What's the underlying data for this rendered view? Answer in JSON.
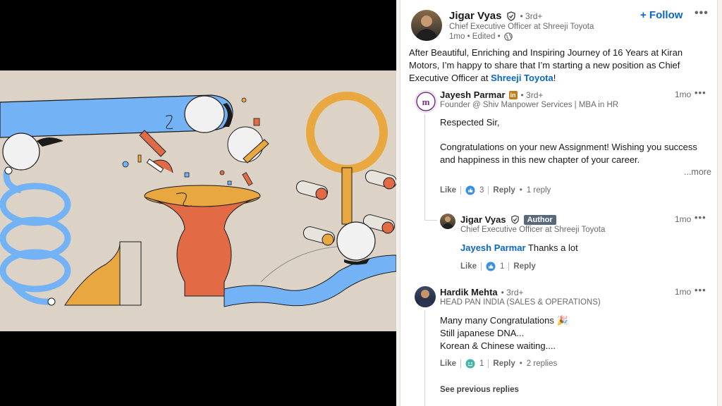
{
  "post": {
    "author_name": "Jigar Vyas",
    "author_degree": "• 3rd+",
    "author_headline": "Chief Executive Officer at Shreeji Toyota",
    "meta_time": "1mo • Edited •",
    "follow_label": "+ Follow",
    "more_label": "•••",
    "text_before": "After Beautiful, Enriching and Inspiring Journey of 16 Years at Kiran Motors, I’m happy to share that I’m starting a new position as Chief Executive Officer at ",
    "text_link": "Shreeji Toyota",
    "text_after": "!"
  },
  "comments": [
    {
      "name": "Jayesh Parmar",
      "degree": "• 3rd+",
      "headline": "Founder @ Shiv Manpower Services | MBA in HR",
      "time": "1mo",
      "line1": "Respected Sir,",
      "line2": "Congratulations on your new Assignment! Wishing you success",
      "line3": "and happiness in this new chapter of your career.",
      "see_more": "...more",
      "like_label": "Like",
      "reaction_count": "3",
      "reply_label": "Reply",
      "replies_label": "1 reply"
    },
    {
      "name": "Jigar Vyas",
      "badge": "Author",
      "headline": "Chief Executive Officer at Shreeji Toyota",
      "time": "1mo",
      "mention": "Jayesh Parmar",
      "text": " Thanks a lot",
      "like_label": "Like",
      "reaction_count": "1",
      "reply_label": "Reply"
    },
    {
      "name": "Hardik Mehta",
      "degree": "• 3rd+",
      "headline": "HEAD PAN INDIA (SALES & OPERATIONS)",
      "time": "1mo",
      "line1": "Many many Congratulations 🎉",
      "line2": "Still japanese DNA...",
      "line3": "Korean & Chinese waiting....",
      "like_label": "Like",
      "reaction_count": "1",
      "reply_label": "Reply",
      "replies_label": "2 replies"
    }
  ],
  "see_previous_label": "See previous replies",
  "colors": {
    "accent": "#0a66c2",
    "art_background": "#dcd3c6",
    "art_blue": "#73b3f5",
    "art_orange": "#e26b45",
    "art_mustard": "#e8a83f"
  }
}
